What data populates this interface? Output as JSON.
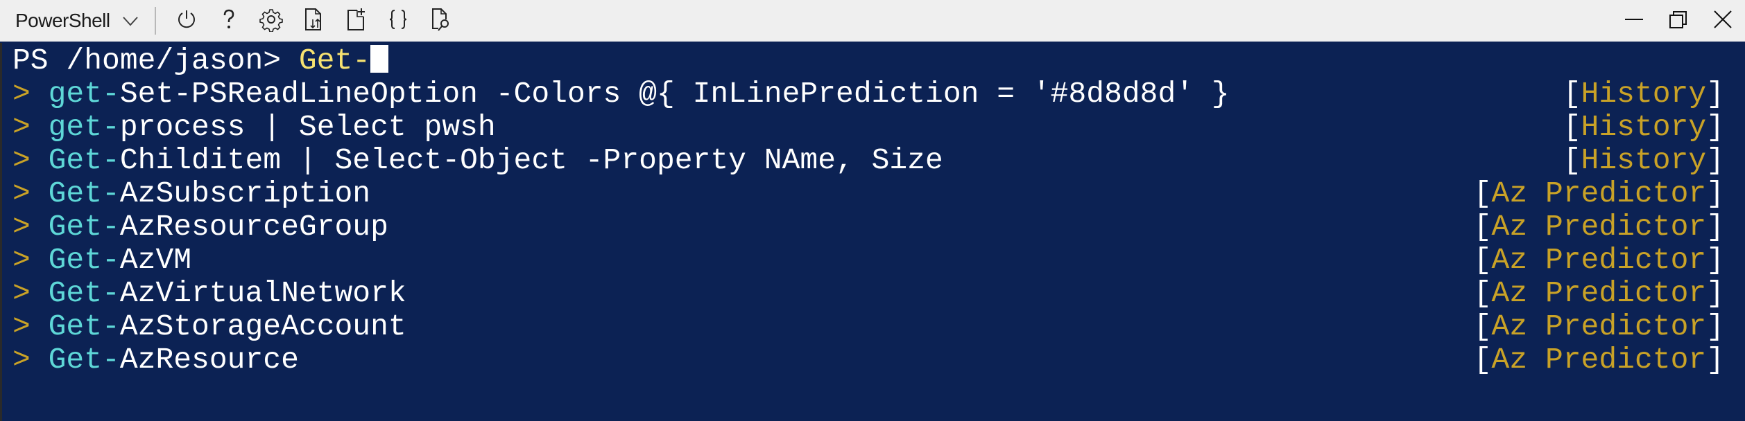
{
  "toolbar": {
    "shell_selector": {
      "label": "PowerShell",
      "icon": "chevron-down-icon"
    },
    "buttons": [
      {
        "name": "restart",
        "icon": "power-icon"
      },
      {
        "name": "help",
        "icon": "help-icon"
      },
      {
        "name": "settings",
        "icon": "gear-icon"
      },
      {
        "name": "upload-download",
        "icon": "file-transfer-icon"
      },
      {
        "name": "new-session",
        "icon": "new-file-icon"
      },
      {
        "name": "editor",
        "icon": "braces-icon"
      },
      {
        "name": "web-preview",
        "icon": "file-search-icon"
      }
    ],
    "window": [
      "minimize-icon",
      "restore-icon",
      "close-icon"
    ]
  },
  "terminal": {
    "prompt": "PS /home/jason> ",
    "typed": "Get-",
    "colors": {
      "background": "#0c2254",
      "typed": "#f6e170",
      "match": "#5ed7d7",
      "marker": "#c9a227",
      "source": "#c9a227",
      "text": "#ffffff"
    },
    "suggestions": [
      {
        "marker": ">",
        "match": "get-",
        "rest": "Set-PSReadLineOption -Colors @{ InLinePrediction = '#8d8d8d' }",
        "source": "History"
      },
      {
        "marker": ">",
        "match": "get-",
        "rest": "process | Select pwsh",
        "source": "History"
      },
      {
        "marker": ">",
        "match": "Get-",
        "rest": "Childitem | Select-Object -Property NAme, Size",
        "source": "History"
      },
      {
        "marker": ">",
        "match": "Get-",
        "rest": "AzSubscription",
        "source": "Az Predictor"
      },
      {
        "marker": ">",
        "match": "Get-",
        "rest": "AzResourceGroup",
        "source": "Az Predictor"
      },
      {
        "marker": ">",
        "match": "Get-",
        "rest": "AzVM",
        "source": "Az Predictor"
      },
      {
        "marker": ">",
        "match": "Get-",
        "rest": "AzVirtualNetwork",
        "source": "Az Predictor"
      },
      {
        "marker": ">",
        "match": "Get-",
        "rest": "AzStorageAccount",
        "source": "Az Predictor"
      },
      {
        "marker": ">",
        "match": "Get-",
        "rest": "AzResource",
        "source": "Az Predictor"
      }
    ],
    "bracket_open": "[",
    "bracket_close": "]"
  }
}
